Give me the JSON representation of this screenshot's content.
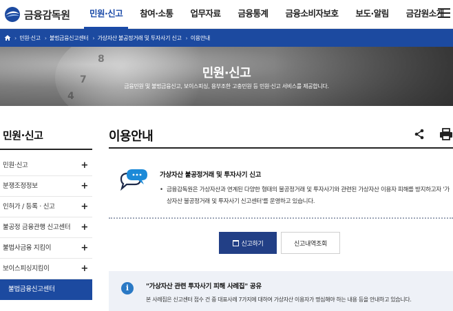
{
  "header": {
    "logo_text": "금융감독원",
    "nav": [
      "민원·신고",
      "참여·소통",
      "업무자료",
      "금융통계",
      "금융소비자보호",
      "보도·알림",
      "금감원소개"
    ],
    "active_nav": "민원·신고"
  },
  "breadcrumb": [
    "민원·신고",
    "불법금융신고센터",
    "가상자산 불공정거래 및 투자사기 신고",
    "이용안내"
  ],
  "hero": {
    "title": "민원·신고",
    "subtitle": "금융민원 및 불법금융신고, 보이스피싱, 용부조한 고충민원 등 민원·신고 서비스를 제공합니다."
  },
  "sidebar": {
    "title": "민원·신고",
    "items": [
      {
        "label": "민원·신고",
        "expandable": true
      },
      {
        "label": "분쟁조정정보",
        "expandable": true
      },
      {
        "label": "인허가 / 등록 · 신고",
        "expandable": true
      },
      {
        "label": "불공정 금융관행 신고센터",
        "expandable": true
      },
      {
        "label": "불법사금융 지킴이",
        "expandable": true
      },
      {
        "label": "보이스피싱지킴이",
        "expandable": true
      },
      {
        "label": "불법금융신고센터",
        "expandable": false,
        "active": true
      }
    ]
  },
  "content": {
    "title": "이용안내",
    "info": {
      "heading": "가상자산 불공정거래 및 투자사기 신고",
      "text": "금융감독원은 가상자산과 연계된 다양한 형태의 불공정거래 및 투자사기와 관련된 가상자산 이용자 피해를 방지하고자 '가상자산 불공정거래 및 투자사기 신고센터'를 운영하고 있습니다."
    },
    "buttons": {
      "report": "신고하기",
      "history": "신고내역조회"
    },
    "notice": {
      "title": "\"가상자산 관련 투자사기 피해 사례집\" 공유",
      "text": "본 사례집은 신고센터 접수 건 중 대표사례 7가지에 대하여 가상자산 이용자가 명심해야 하는 내용 등을 안내하고 있습니다."
    }
  },
  "colors": {
    "brand_blue": "#1c4aa0",
    "button_navy": "#223f86",
    "info_blue": "#2a79c5"
  }
}
